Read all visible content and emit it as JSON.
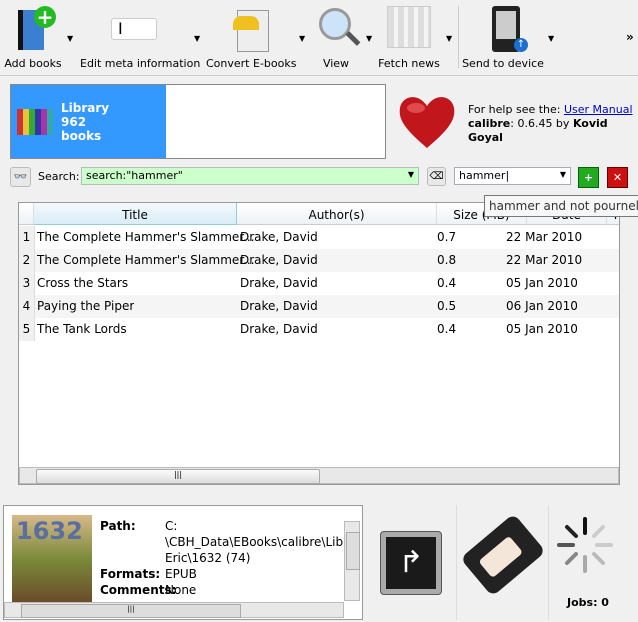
{
  "toolbar": {
    "items": [
      {
        "label": "Add books",
        "icon": "add-books-icon"
      },
      {
        "label": "Edit meta information",
        "icon": "edit-metadata-icon"
      },
      {
        "label": "Convert E-books",
        "icon": "convert-icon"
      },
      {
        "label": "View",
        "icon": "magnifier-icon"
      },
      {
        "label": "Fetch news",
        "icon": "newspaper-icon"
      },
      {
        "label": "Send to device",
        "icon": "ereader-icon"
      }
    ],
    "overflow": "»"
  },
  "library": {
    "name": "Library",
    "count": "962",
    "unit": "books"
  },
  "help": {
    "prefix": "For help see the: ",
    "link": "User Manual",
    "app": "calibre",
    "version": ": 0.6.45 by ",
    "author": "Kovid Goyal"
  },
  "search": {
    "label": "Search:",
    "value": "search:\"hammer\"",
    "saved_value": "hammer",
    "tooltip": "hammer and not pournelle a"
  },
  "table": {
    "columns": [
      "Title",
      "Author(s)",
      "Size (MB)",
      "Date",
      "Ra"
    ],
    "rows": [
      {
        "n": "1",
        "title": "The Complete Hammer's Slammer...",
        "author": "Drake, David",
        "size": "0.7",
        "date": "22 Mar 2010"
      },
      {
        "n": "2",
        "title": "The Complete Hammer's Slammer...",
        "author": "Drake, David",
        "size": "0.8",
        "date": "22 Mar 2010"
      },
      {
        "n": "3",
        "title": "Cross the Stars",
        "author": "Drake, David",
        "size": "0.4",
        "date": "05 Jan 2010"
      },
      {
        "n": "4",
        "title": "Paying the Piper",
        "author": "Drake, David",
        "size": "0.5",
        "date": "06 Jan 2010"
      },
      {
        "n": "5",
        "title": "The Tank Lords",
        "author": "Drake, David",
        "size": "0.4",
        "date": "05 Jan 2010"
      }
    ]
  },
  "details": {
    "cover_text": "1632",
    "path_label": "Path:",
    "path_lines": [
      "C:",
      "\\CBH_Data\\EBooks\\calibre\\Library",
      "Eric\\1632 (74)"
    ],
    "formats_label": "Formats:",
    "formats": "EPUB",
    "comments_label": "Comments:",
    "comments": "None"
  },
  "jobs": {
    "label": "Jobs: 0"
  },
  "colors": {
    "accent": "#3399ff",
    "search_bg": "#ccffcc"
  }
}
